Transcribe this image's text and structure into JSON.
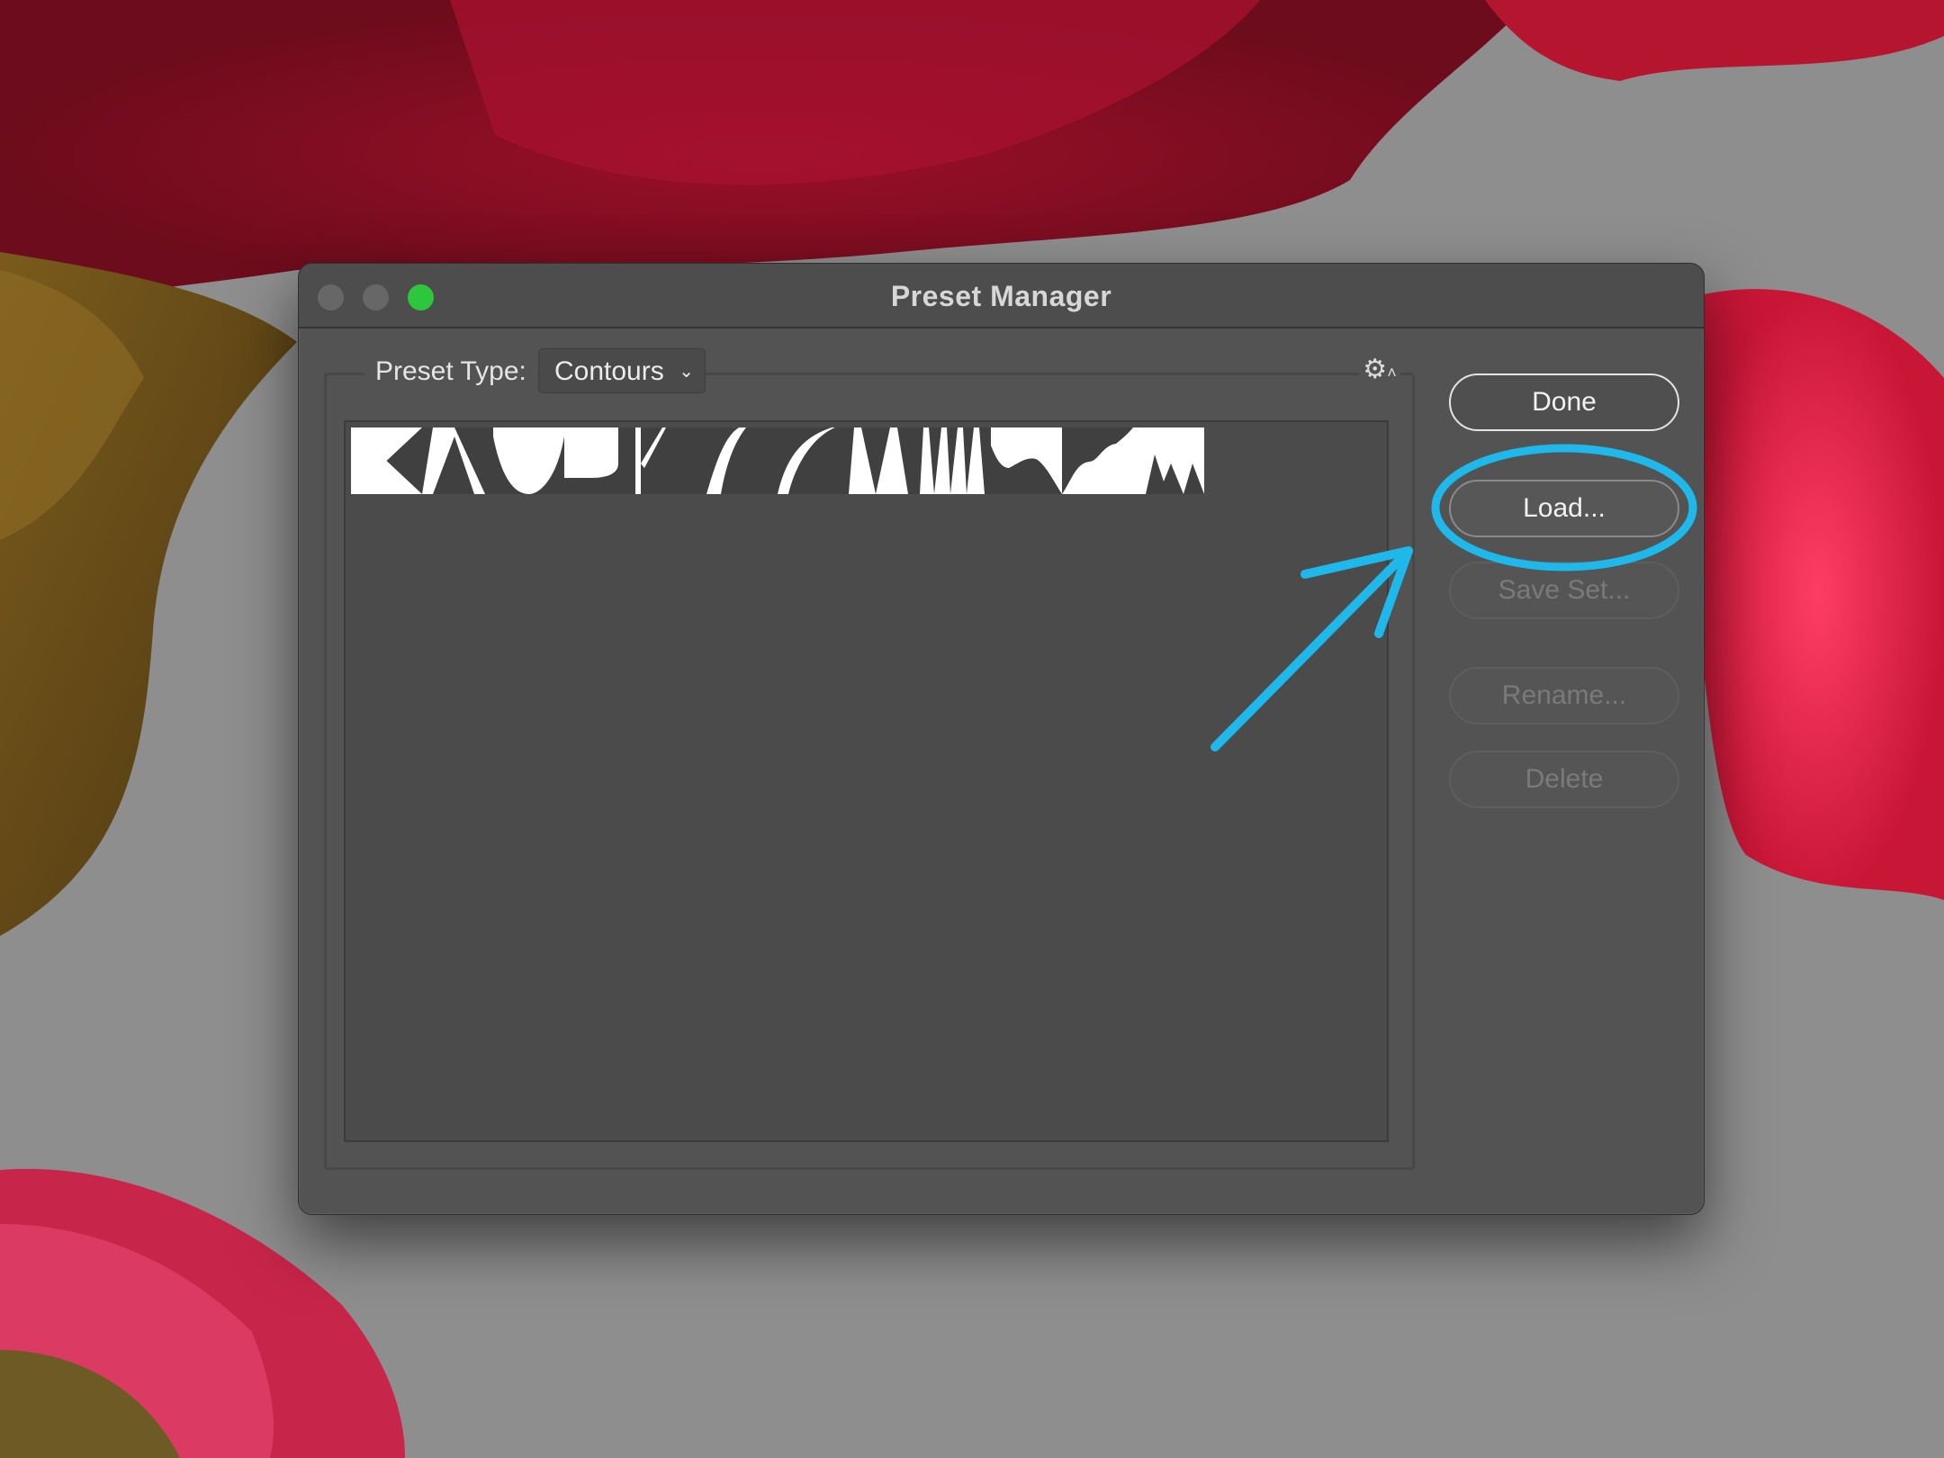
{
  "window": {
    "title": "Preset Manager",
    "traffic_lights": [
      "close",
      "minimize",
      "maximize"
    ]
  },
  "preset_type": {
    "label": "Preset Type:",
    "value": "Contours",
    "chevron_icon": "chevron-down-icon",
    "gear_icon": "gear-icon"
  },
  "contour_presets": [
    "linear",
    "cone",
    "cove-deep",
    "half-round",
    "ring",
    "rounded-steps",
    "sawtooth",
    "gaussian",
    "ring-double",
    "rolling-slope",
    "cove-shallow",
    "peaks"
  ],
  "buttons": {
    "done": "Done",
    "load": "Load...",
    "save_set": "Save Set...",
    "rename": "Rename...",
    "delete": "Delete"
  },
  "colors": {
    "annotation": "#1fb8ea",
    "maximize": "#2cc73d"
  }
}
